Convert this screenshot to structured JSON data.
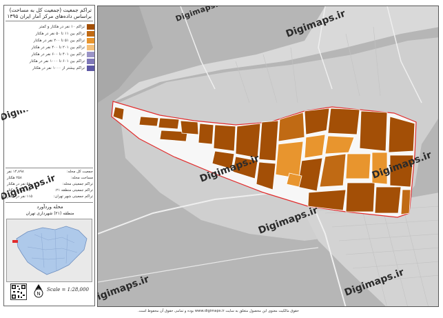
{
  "title_lines": [
    "تراکم جمعیت (جمعیت کل به مساحت)",
    "براساس داده‌های مرکز آمار ایران ۱۳۹۵"
  ],
  "legend": [
    {
      "label": "تراکم ۱۰ نفر در هکتار و کمتر",
      "color": "#a34f06"
    },
    {
      "label": "تراکم بین ۱۱ تا ۵۰ نفر در هکتار",
      "color": "#c06a14"
    },
    {
      "label": "تراکم بین ۵۱ تا ۲۰۰ نفر در هکتار",
      "color": "#e8952e"
    },
    {
      "label": "تراکم بین ۲۰۱ تا ۴۰۰ نفر در هکتار",
      "color": "#f4c07a"
    },
    {
      "label": "تراکم بین ۴۰۱ تا ۶۰۰ نفر در هکتار",
      "color": "#9a93c6"
    },
    {
      "label": "تراکم بین ۶۰۱ تا ۱۰۰۰ نفر در هکتار",
      "color": "#7f78b8"
    },
    {
      "label": "تراکم بیشتر از ۱۰۰۰ نفر در هکتار",
      "color": "#5c57a4"
    }
  ],
  "stats": [
    {
      "label": "جمعیت کل محله:",
      "value": "۱۴,۸۹۸ نفر"
    },
    {
      "label": "مساحت محله:",
      "value": "۲۵۸ هکتار"
    },
    {
      "label": "تراکم جمعیتی محله:",
      "value": "۵۸ نفر در هکتار"
    },
    {
      "label": "تراکم جمعیتی منطقه ۲۱:",
      "value": "۳۸ نفر در هکتار"
    },
    {
      "label": "تراکم جمعیتی شهر تهران:",
      "value": "۱۱۵ نفر در هکتار"
    }
  ],
  "area_name": "محله وردآورد",
  "area_sub": "منطقه (۲۱) شهرداری تهران",
  "scale": "Scale = 1:28,000",
  "watermark": "Digimaps.ir",
  "copyright": "حقوق مالکیت معنوی این محصول متعلق به سایت www.digimaps.ir بوده و تمامی حقوق آن محفوظ است.",
  "colors": {
    "background": "#ffffff",
    "map_bg": "#b9b9b9",
    "boundary": "#e22c2c",
    "dark_block": "#a34f06",
    "light_block": "#e8952e"
  },
  "icons": [
    "north-arrow-icon",
    "qr-code-icon"
  ]
}
